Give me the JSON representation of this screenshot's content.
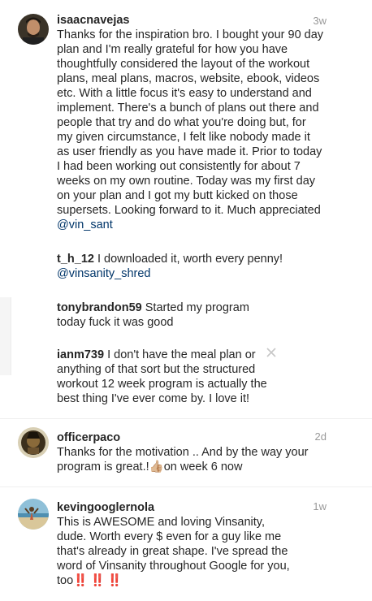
{
  "comments": [
    {
      "username": "isaacnavejas",
      "time": "3w",
      "text": "Thanks for the inspiration bro. I bought your 90 day plan and I'm really grateful for how you have thoughtfully considered the layout of the workout plans, meal plans, macros, website, ebook, videos etc. With a little focus it's easy to understand and implement. There's a bunch of plans out there and people that try and do what you're doing but, for my given circumstance, I felt like nobody made it as user friendly as you have made it. Prior to today I had been working out consistently for about 7 weeks on my own routine. Today was my first day on your plan and I got my butt kicked on those supersets. Looking forward to it.  Much appreciated",
      "mention": "@vin_sant"
    },
    {
      "username": "officerpaco",
      "time": "2d",
      "text": "Thanks for the motivation .. And by the way your program is great.!",
      "emoji": "👍🏼",
      "text2": "on week 6 now"
    },
    {
      "username": "kevingooglernola",
      "time": "1w",
      "text": "This is AWESOME and loving Vinsanity, dude. Worth every $ even for a guy like me that's already in great shape. I've spread the word of Vinsanity throughout Google for you, too",
      "bangs": [
        "‼️",
        "‼️",
        "‼️"
      ]
    }
  ],
  "replies": [
    {
      "username": "t_h_12",
      "text": "I downloaded it, worth every penny!",
      "mention": "@vinsanity_shred"
    },
    {
      "username": "tonybrandon59",
      "text": "Started my program today fuck it was good"
    },
    {
      "username": "ianm739",
      "text": "I don't have the meal plan or anything of that sort but the structured workout 12 week program is actually the best thing I've ever come by. I love it!"
    }
  ],
  "colors": {
    "text": "#262626",
    "mention": "#003569",
    "timestamp": "#999999",
    "bangs": "#e0161b"
  },
  "icons": {
    "close": "close-icon"
  }
}
